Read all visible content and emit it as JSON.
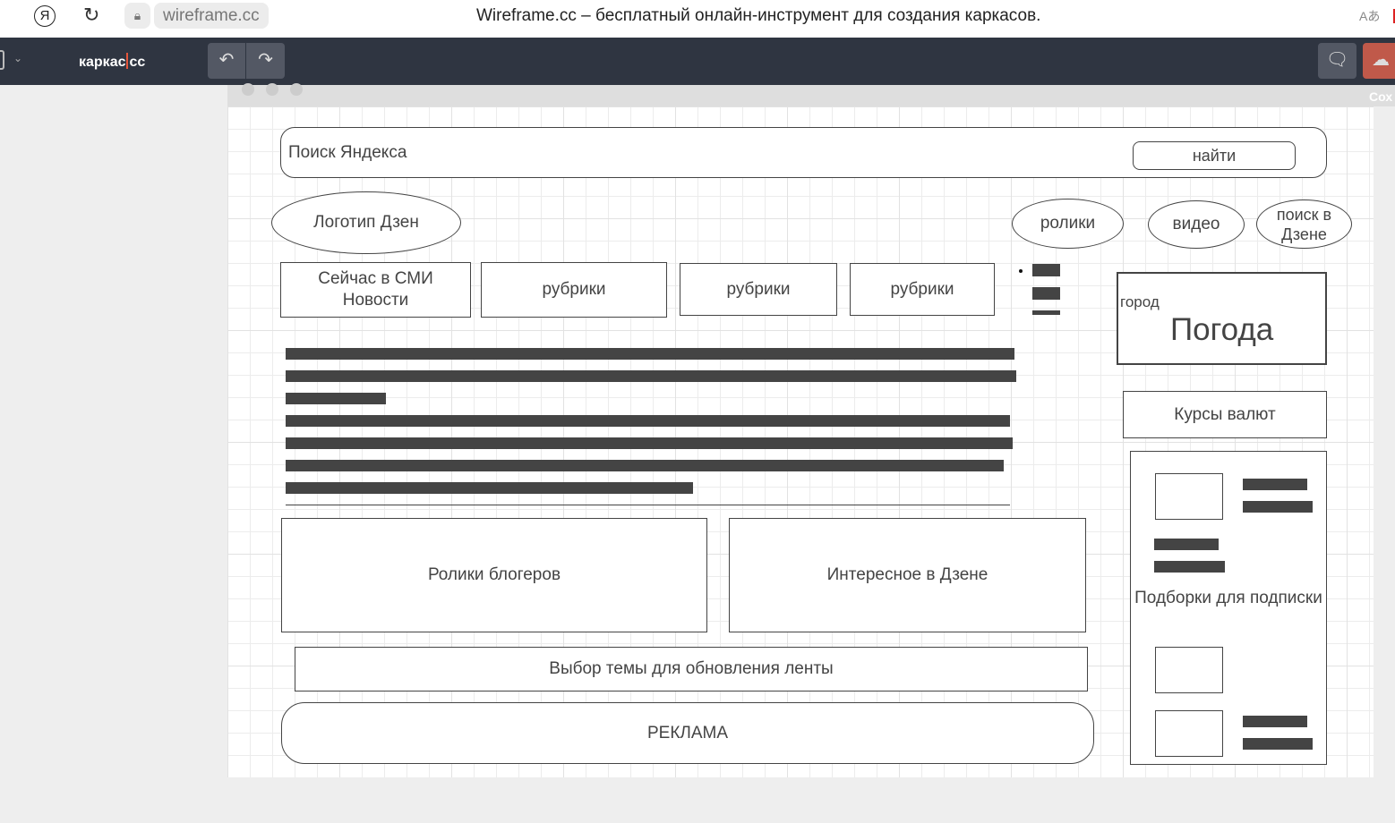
{
  "browser": {
    "url": "wireframe.cc",
    "title": "Wireframe.cc – бесплатный онлайн-инструмент для создания каркасов.",
    "ya": "Я",
    "translate": "Aあ"
  },
  "app": {
    "logo_left": "каркас",
    "logo_right": "cc",
    "undo": "↶",
    "redo": "↷",
    "save_label": "Сох"
  },
  "wireframe": {
    "search_placeholder": "Поиск Яндекса",
    "search_button": "найти",
    "logo": "Логотип Дзен",
    "nav": [
      "ролики",
      "видео",
      "поиск в Дзене"
    ],
    "tabs": [
      "Сейчас в СМИ Новости",
      "рубрики",
      "рубрики",
      "рубрики"
    ],
    "weather_city": "город",
    "weather": "Погода",
    "currency": "Курсы валют",
    "subscriptions": "Подборки для подписки",
    "bloggers": "Ролики блогеров",
    "interesting": "Интересное в Дзене",
    "topic": "Выбор темы для обновления ленты",
    "ads": "РЕКЛАМА"
  }
}
